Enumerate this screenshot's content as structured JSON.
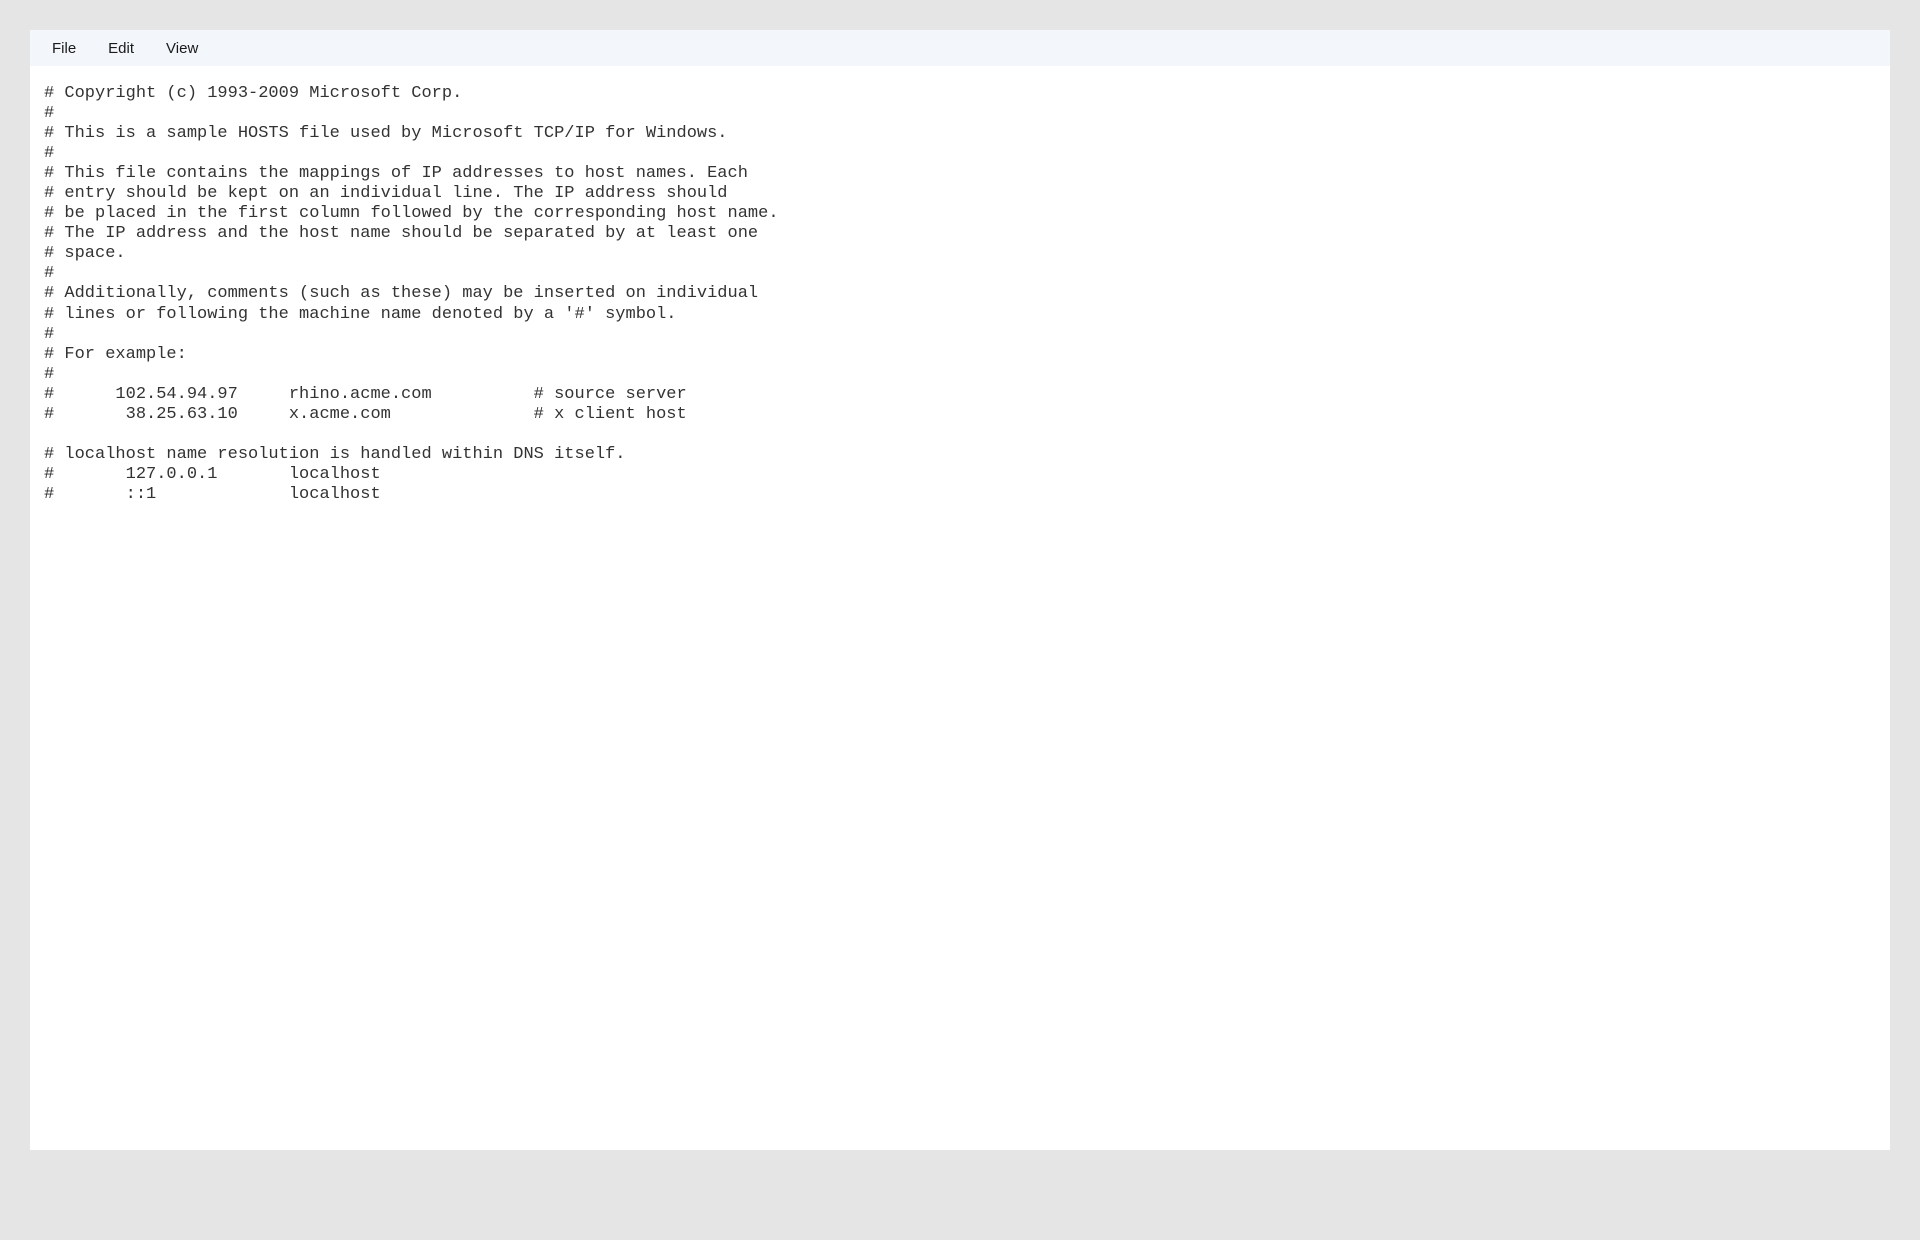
{
  "menu": {
    "file": "File",
    "edit": "Edit",
    "view": "View"
  },
  "content": {
    "lines": [
      "# Copyright (c) 1993-2009 Microsoft Corp.",
      "#",
      "# This is a sample HOSTS file used by Microsoft TCP/IP for Windows.",
      "#",
      "# This file contains the mappings of IP addresses to host names. Each",
      "# entry should be kept on an individual line. The IP address should",
      "# be placed in the first column followed by the corresponding host name.",
      "# The IP address and the host name should be separated by at least one",
      "# space.",
      "#",
      "# Additionally, comments (such as these) may be inserted on individual",
      "# lines or following the machine name denoted by a '#' symbol.",
      "#",
      "# For example:",
      "#",
      "#      102.54.94.97     rhino.acme.com          # source server",
      "#       38.25.63.10     x.acme.com              # x client host",
      "",
      "# localhost name resolution is handled within DNS itself.",
      "#\t127.0.0.1       localhost",
      "#\t::1             localhost"
    ]
  }
}
